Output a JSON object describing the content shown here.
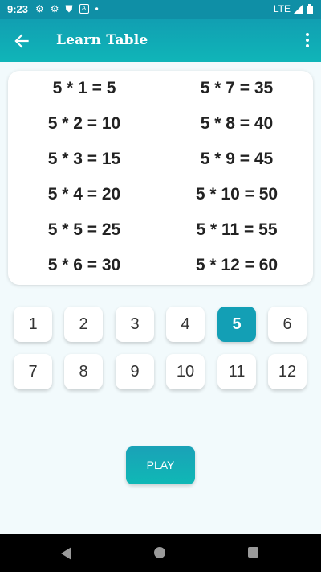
{
  "status_bar": {
    "time": "9:23",
    "network": "LTE",
    "icons": [
      "settings-icon",
      "settings-icon",
      "shield-icon",
      "app-icon",
      "dot-icon",
      "signal-icon",
      "battery-icon"
    ]
  },
  "app_bar": {
    "title": "Learn Table",
    "back_icon": "arrow-left-icon",
    "menu_icon": "more-vert-icon"
  },
  "table": {
    "left": [
      "5 * 1 = 5",
      "5 * 2 = 10",
      "5 * 3 = 15",
      "5 * 4 = 20",
      "5 * 5 = 25",
      "5 * 6 = 30"
    ],
    "right": [
      "5 * 7 = 35",
      "5 * 8 = 40",
      "5 * 9 = 45",
      "5 * 10 = 50",
      "5 * 11 = 55",
      "5 * 12 = 60"
    ]
  },
  "numbers": {
    "selected": "5",
    "items": [
      "1",
      "2",
      "3",
      "4",
      "5",
      "6",
      "7",
      "8",
      "9",
      "10",
      "11",
      "12"
    ]
  },
  "play_label": "PLAY",
  "colors": {
    "accent": "#139fb5",
    "app_bar": "#10a8b4",
    "background": "#f2fafc"
  }
}
